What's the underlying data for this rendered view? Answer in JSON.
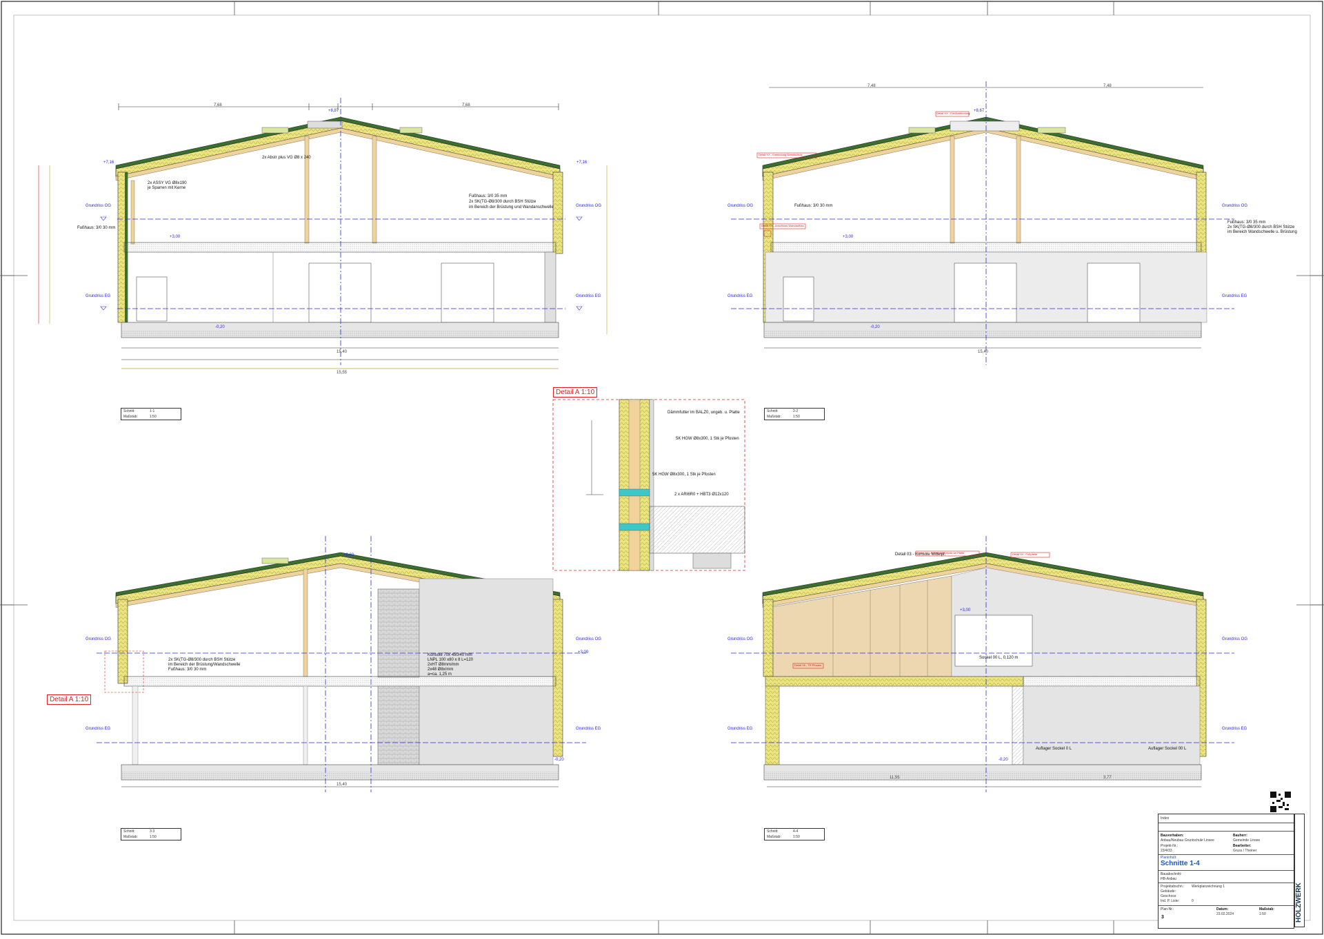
{
  "sections": [
    {
      "id": "s11",
      "scale_box": {
        "k1": "Schnitt:",
        "v1": "1-1",
        "k2": "Maßstab:",
        "v2": "1:50"
      },
      "labels": {
        "grundriss_og_l": "Grundriss OG",
        "grundriss_og_r": "Grundriss OG",
        "grundriss_eg_l": "Grundriss EG",
        "grundriss_eg_r": "Grundriss EG",
        "fusshaus": "Fußhaus: 3/0 30 mm",
        "fusshaus_r": "Fußhaus: 3/0 35 mm",
        "note_r2": "2x SK(TG-Ø8/300 durch BSH Stütze",
        "note_r3": "im Bereich der Brüstung und Wandanschwelle",
        "note_c": "2x Abstr plus VG Ø8 x 240",
        "note_l1": "2x ASSY VG Ø8x190",
        "note_l2": "je Sparren mit Kerne",
        "dim_total": "15,55",
        "dim_mid": "15,40",
        "dim_top_l": "7,68",
        "dim_top_r": "7,68",
        "elev_top": "+8,87",
        "elev_l1": "+7,16",
        "elev_r1": "+7,16",
        "elev_og": "+3,00",
        "elev_eg": "-0,20"
      }
    },
    {
      "id": "s22",
      "scale_box": {
        "k1": "Schnitt:",
        "v1": "2-2",
        "k2": "Maßstab:",
        "v2": "1:50"
      },
      "labels": {
        "grundriss_og_l": "Grundriss OG",
        "grundriss_og_r": "Grundriss OG",
        "grundriss_eg_l": "Grundriss EG",
        "grundriss_eg_r": "Grundriss EG",
        "fusshaus": "Fußhaus: 3/0 30 mm",
        "fusshaus_r": "Fußhaus: 3/0 35 mm",
        "note_r2": "2x SK(TG-Ø8/300 durch BSH Stütze",
        "note_r3": "im Bereich Wandschwelle u. Brüstung",
        "red_tag_1": "Detail XX - Ein/Ausbindung",
        "red_tag_2": "Detail XX - Einbindung Brandschutz",
        "red_tag_3": "Detail XX - Anschluss Wandaufbau",
        "dim_total": "15,40",
        "dim_top_l": "7,48",
        "dim_top_r": "7,48",
        "elev_top": "+8,67",
        "elev_og": "+3,00",
        "elev_eg": "-0,20"
      }
    },
    {
      "id": "s33",
      "scale_box": {
        "k1": "Schnitt:",
        "v1": "3-3",
        "k2": "Maßstab:",
        "v2": "1:50"
      },
      "labels": {
        "grundriss_og_l": "Grundriss OG",
        "grundriss_og_r": "Grundriss OG",
        "grundriss_eg_l": "Grundriss EG",
        "grundriss_eg_r": "Grundriss EG",
        "note_1": "2x SK(TG-Ø8/300 durch BSH Stütze",
        "note_2": "im Bereich der Brüstung/Wandschwelle",
        "note_3": "Fußhaus: 3/0 30 mm",
        "note_r": "Konsole 70x 450/40 mm",
        "note_r2": "LNPL 100 x80 x 8 L=120",
        "note_r3": "2xHT Ø8mm/mm",
        "note_r4": "2x48 Ø8x/mm",
        "note_r5": "a=ca. 1,25 m",
        "dim_total": "15,40",
        "elev_top": "+8,60",
        "elev_og": "+3,00",
        "elev_eg": "-0,20"
      }
    },
    {
      "id": "s44",
      "scale_box": {
        "k1": "Schnitt:",
        "v1": "4-4",
        "k2": "Maßstab:",
        "v2": "1:50"
      },
      "labels": {
        "grundriss_og_l": "Grundriss OG",
        "grundriss_og_r": "Grundriss OG",
        "grundriss_eg_l": "Grundriss EG",
        "grundriss_eg_r": "Grundriss EG",
        "top_note": "Detail 03 - Konsole Mittelpf.",
        "red_tag_1": "Detail 01 - Sparrenanschluss an Pfette",
        "red_tag_2": "Detail 04 - Fußpfette",
        "red_tag_3": "Detail 06 - TR Pfosten",
        "note_sockel": "Sockel 00 L, 0,120 m",
        "note_auf1": "Auflager Sockel 0 L",
        "note_auf2": "Auflager Sockel 00 L",
        "dim_l": "11,55",
        "dim_r": "3,77",
        "elev_og": "+3,00",
        "elev_eg": "-0,20"
      }
    }
  ],
  "detail_a": {
    "title": "Detail A 1:10",
    "tag_left": "Detail A 1:10",
    "notes": [
      "Dämmfutter im BALZ0, ungeb. u. Platte",
      "5K HGW Ø8x300, 1 Stk je Pfosten",
      "5K HGW Ø8x300, 1 Stk je Pfosten",
      "2 x ARI6R0 + HBT3 Ø12x120"
    ]
  },
  "title_block": {
    "index_label": "Index",
    "bauvorhaben_label": "Bauvorhaben:",
    "bauvorhaben_value": "Anbau/Neubau Gruntschule Linsee",
    "bauherr_label": "Bauherr:",
    "bauherr_value": "Gemeinde Linsee",
    "projekt_label": "Projekt-Nr.:",
    "projekt_value": "23/4/33",
    "bearbeiter_label": "Bearbeiter:",
    "bearbeiter_value": "Gruss / Theiner",
    "planinhalt_label": "Planinhalt:",
    "planinhalt_value": "Schnitte 1-4",
    "bauabschnitt_label": "Bauabschnitt:",
    "bauabschnitt_value": "HB-Anbau",
    "planstatus_label": "Projektabschn.:",
    "planstatus_value": "Werkplanzeichnung 1",
    "gebaeude_label": "Gebäude:",
    "geschoss_label": "Geschoss:",
    "index_nr_label": "Ind. P. Liste:",
    "index_nr_value": "0",
    "plan_nr_label": "Plan-Nr.:",
    "plan_nr_value": "3",
    "datum_label": "Datum:",
    "datum_value": "23.02.2024",
    "massstab_label": "Maßstab:",
    "massstab_value": "1:50",
    "firm": "HOLZWERK",
    "firm_accent": "#1aa7c8",
    "title_color": "#1a56c8"
  },
  "colors": {
    "section_line": "#2a2ae0",
    "red": "#e02020",
    "insulation": "#e6e07a",
    "timber": "#f0d39a",
    "roof_tile": "#3a6f2e",
    "slab": "#cfcfcf",
    "wall_fill": "#e2e2e2"
  }
}
